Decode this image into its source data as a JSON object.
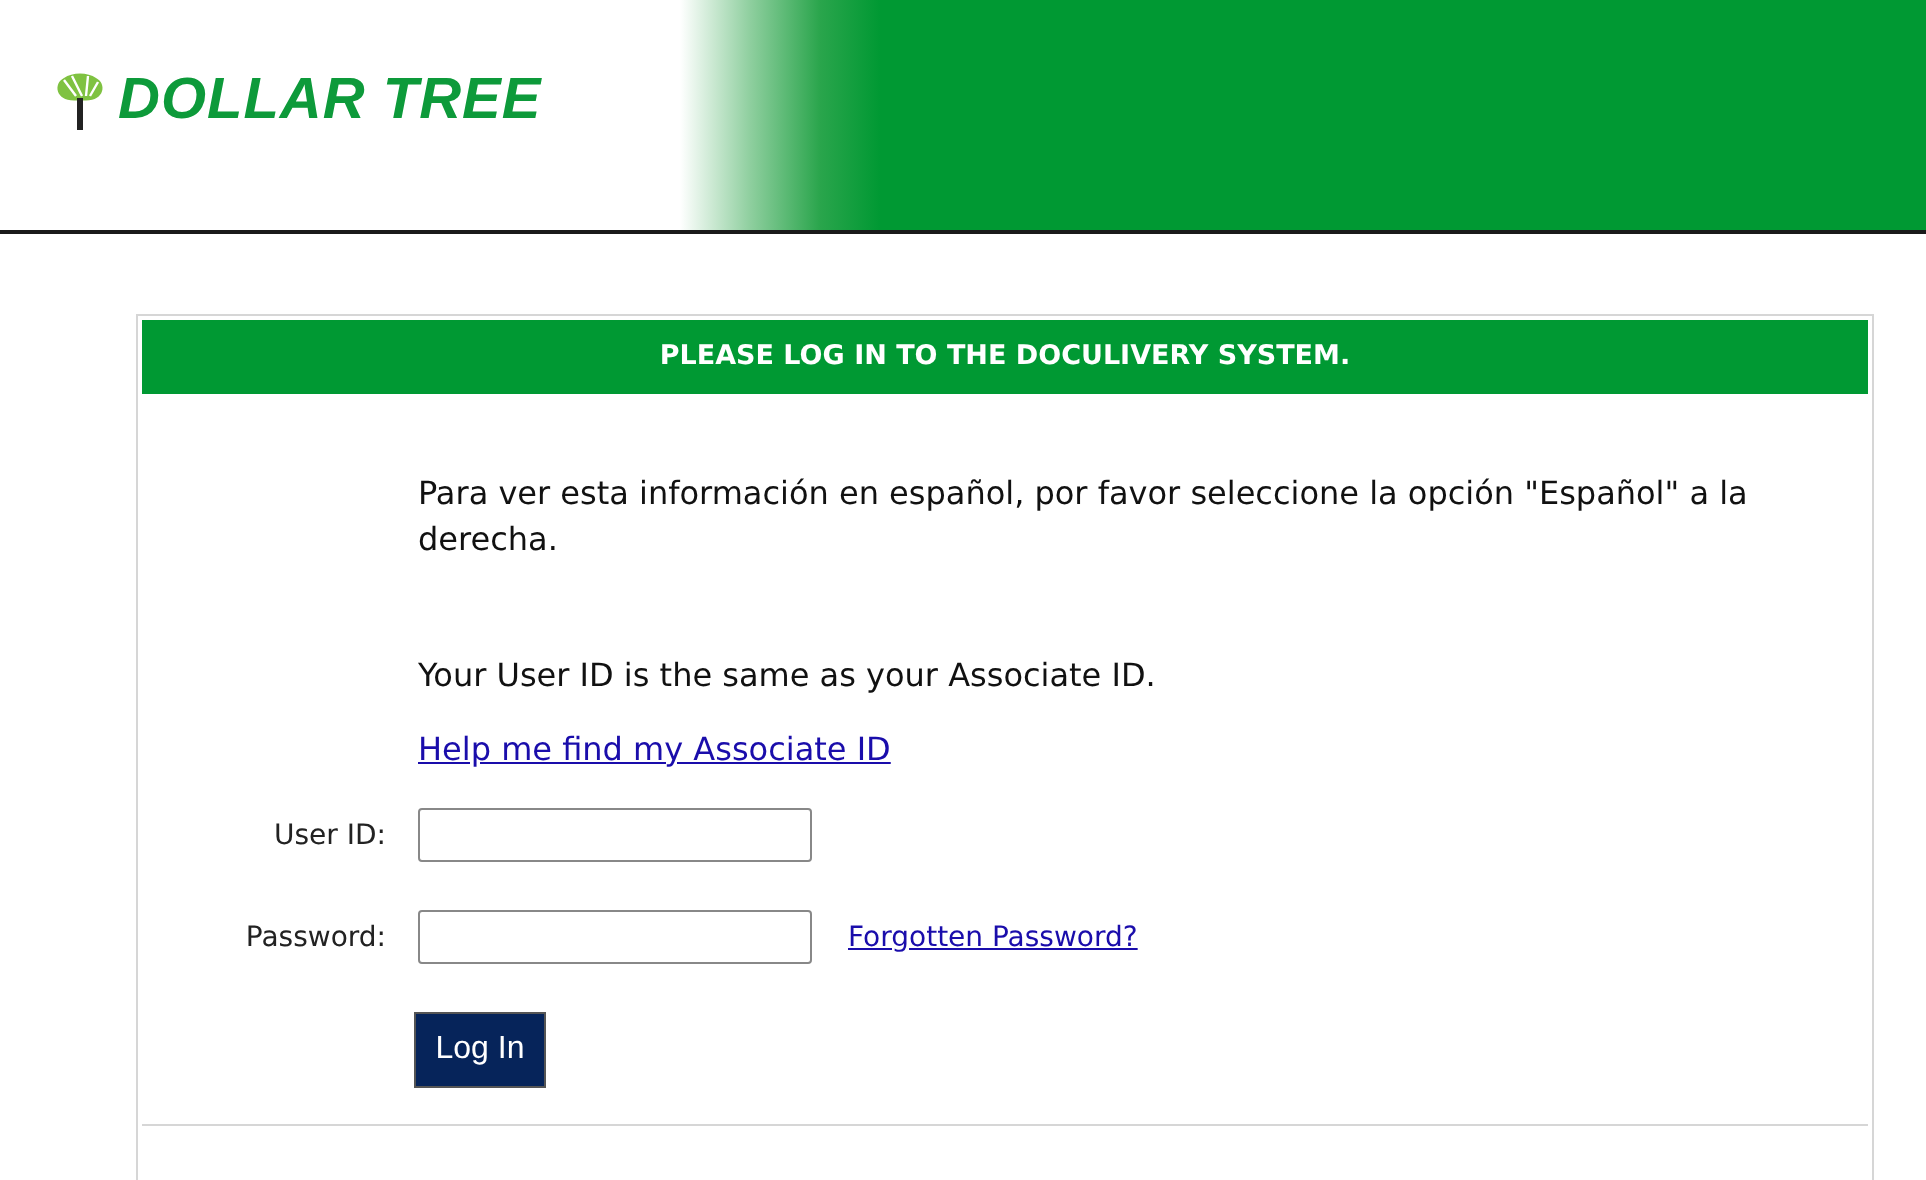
{
  "header": {
    "logo_text": "DOLLAR TREE"
  },
  "panel": {
    "title": "PLEASE LOG IN TO THE DOCULIVERY SYSTEM.",
    "notice": "Para ver esta información en español, por favor seleccione la opción \"Español\" a la derecha.",
    "info": "Your User ID is the same as your Associate ID.",
    "help_link": "Help me find my Associate ID",
    "fields": [
      {
        "label": "User ID:"
      },
      {
        "label": "Password:",
        "link": "Forgotten Password?"
      }
    ],
    "button": "Log In"
  }
}
